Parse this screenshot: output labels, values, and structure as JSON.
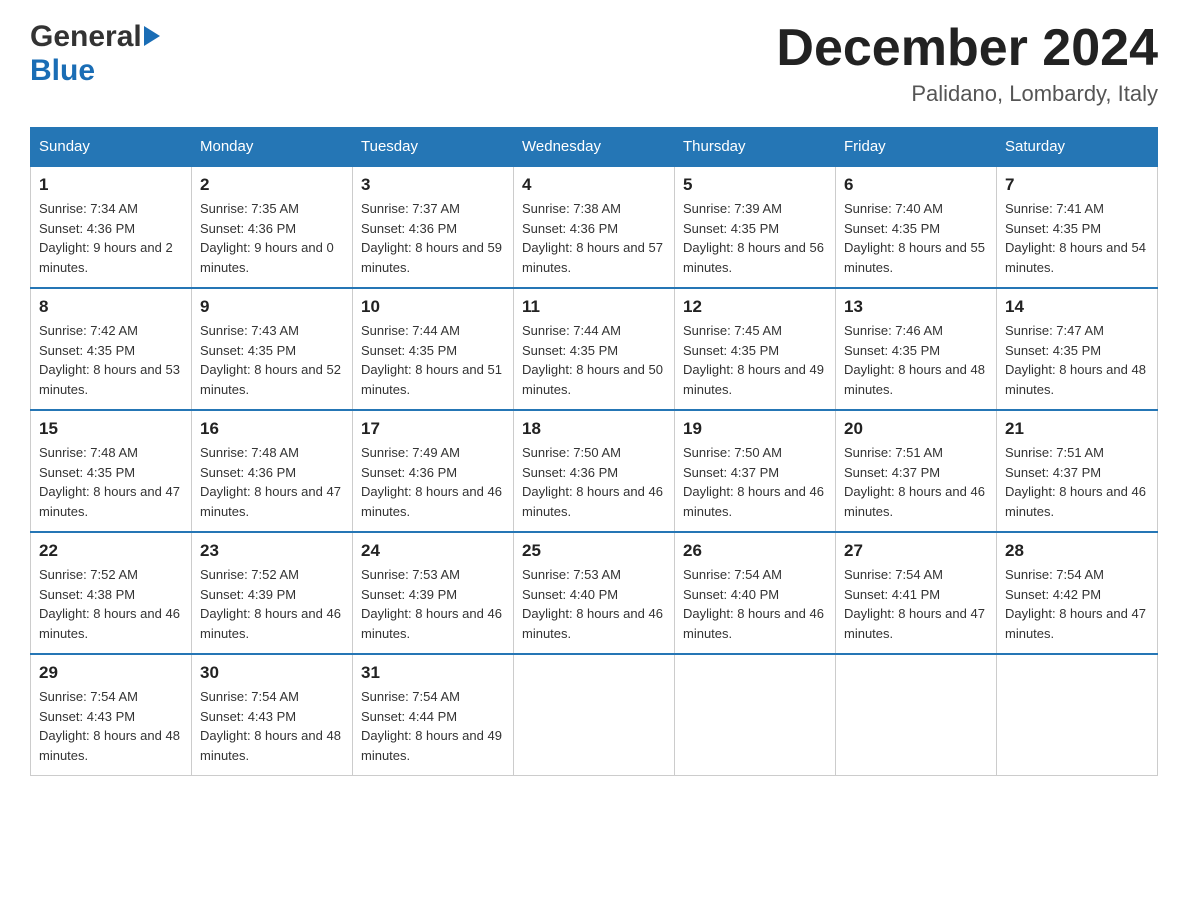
{
  "header": {
    "logo_general": "General",
    "logo_blue": "Blue",
    "month_title": "December 2024",
    "location": "Palidano, Lombardy, Italy"
  },
  "days_of_week": [
    "Sunday",
    "Monday",
    "Tuesday",
    "Wednesday",
    "Thursday",
    "Friday",
    "Saturday"
  ],
  "weeks": [
    [
      {
        "day": "1",
        "sunrise": "7:34 AM",
        "sunset": "4:36 PM",
        "daylight": "9 hours and 2 minutes."
      },
      {
        "day": "2",
        "sunrise": "7:35 AM",
        "sunset": "4:36 PM",
        "daylight": "9 hours and 0 minutes."
      },
      {
        "day": "3",
        "sunrise": "7:37 AM",
        "sunset": "4:36 PM",
        "daylight": "8 hours and 59 minutes."
      },
      {
        "day": "4",
        "sunrise": "7:38 AM",
        "sunset": "4:36 PM",
        "daylight": "8 hours and 57 minutes."
      },
      {
        "day": "5",
        "sunrise": "7:39 AM",
        "sunset": "4:35 PM",
        "daylight": "8 hours and 56 minutes."
      },
      {
        "day": "6",
        "sunrise": "7:40 AM",
        "sunset": "4:35 PM",
        "daylight": "8 hours and 55 minutes."
      },
      {
        "day": "7",
        "sunrise": "7:41 AM",
        "sunset": "4:35 PM",
        "daylight": "8 hours and 54 minutes."
      }
    ],
    [
      {
        "day": "8",
        "sunrise": "7:42 AM",
        "sunset": "4:35 PM",
        "daylight": "8 hours and 53 minutes."
      },
      {
        "day": "9",
        "sunrise": "7:43 AM",
        "sunset": "4:35 PM",
        "daylight": "8 hours and 52 minutes."
      },
      {
        "day": "10",
        "sunrise": "7:44 AM",
        "sunset": "4:35 PM",
        "daylight": "8 hours and 51 minutes."
      },
      {
        "day": "11",
        "sunrise": "7:44 AM",
        "sunset": "4:35 PM",
        "daylight": "8 hours and 50 minutes."
      },
      {
        "day": "12",
        "sunrise": "7:45 AM",
        "sunset": "4:35 PM",
        "daylight": "8 hours and 49 minutes."
      },
      {
        "day": "13",
        "sunrise": "7:46 AM",
        "sunset": "4:35 PM",
        "daylight": "8 hours and 48 minutes."
      },
      {
        "day": "14",
        "sunrise": "7:47 AM",
        "sunset": "4:35 PM",
        "daylight": "8 hours and 48 minutes."
      }
    ],
    [
      {
        "day": "15",
        "sunrise": "7:48 AM",
        "sunset": "4:35 PM",
        "daylight": "8 hours and 47 minutes."
      },
      {
        "day": "16",
        "sunrise": "7:48 AM",
        "sunset": "4:36 PM",
        "daylight": "8 hours and 47 minutes."
      },
      {
        "day": "17",
        "sunrise": "7:49 AM",
        "sunset": "4:36 PM",
        "daylight": "8 hours and 46 minutes."
      },
      {
        "day": "18",
        "sunrise": "7:50 AM",
        "sunset": "4:36 PM",
        "daylight": "8 hours and 46 minutes."
      },
      {
        "day": "19",
        "sunrise": "7:50 AM",
        "sunset": "4:37 PM",
        "daylight": "8 hours and 46 minutes."
      },
      {
        "day": "20",
        "sunrise": "7:51 AM",
        "sunset": "4:37 PM",
        "daylight": "8 hours and 46 minutes."
      },
      {
        "day": "21",
        "sunrise": "7:51 AM",
        "sunset": "4:37 PM",
        "daylight": "8 hours and 46 minutes."
      }
    ],
    [
      {
        "day": "22",
        "sunrise": "7:52 AM",
        "sunset": "4:38 PM",
        "daylight": "8 hours and 46 minutes."
      },
      {
        "day": "23",
        "sunrise": "7:52 AM",
        "sunset": "4:39 PM",
        "daylight": "8 hours and 46 minutes."
      },
      {
        "day": "24",
        "sunrise": "7:53 AM",
        "sunset": "4:39 PM",
        "daylight": "8 hours and 46 minutes."
      },
      {
        "day": "25",
        "sunrise": "7:53 AM",
        "sunset": "4:40 PM",
        "daylight": "8 hours and 46 minutes."
      },
      {
        "day": "26",
        "sunrise": "7:54 AM",
        "sunset": "4:40 PM",
        "daylight": "8 hours and 46 minutes."
      },
      {
        "day": "27",
        "sunrise": "7:54 AM",
        "sunset": "4:41 PM",
        "daylight": "8 hours and 47 minutes."
      },
      {
        "day": "28",
        "sunrise": "7:54 AM",
        "sunset": "4:42 PM",
        "daylight": "8 hours and 47 minutes."
      }
    ],
    [
      {
        "day": "29",
        "sunrise": "7:54 AM",
        "sunset": "4:43 PM",
        "daylight": "8 hours and 48 minutes."
      },
      {
        "day": "30",
        "sunrise": "7:54 AM",
        "sunset": "4:43 PM",
        "daylight": "8 hours and 48 minutes."
      },
      {
        "day": "31",
        "sunrise": "7:54 AM",
        "sunset": "4:44 PM",
        "daylight": "8 hours and 49 minutes."
      },
      null,
      null,
      null,
      null
    ]
  ],
  "labels": {
    "sunrise": "Sunrise:",
    "sunset": "Sunset:",
    "daylight": "Daylight:"
  }
}
